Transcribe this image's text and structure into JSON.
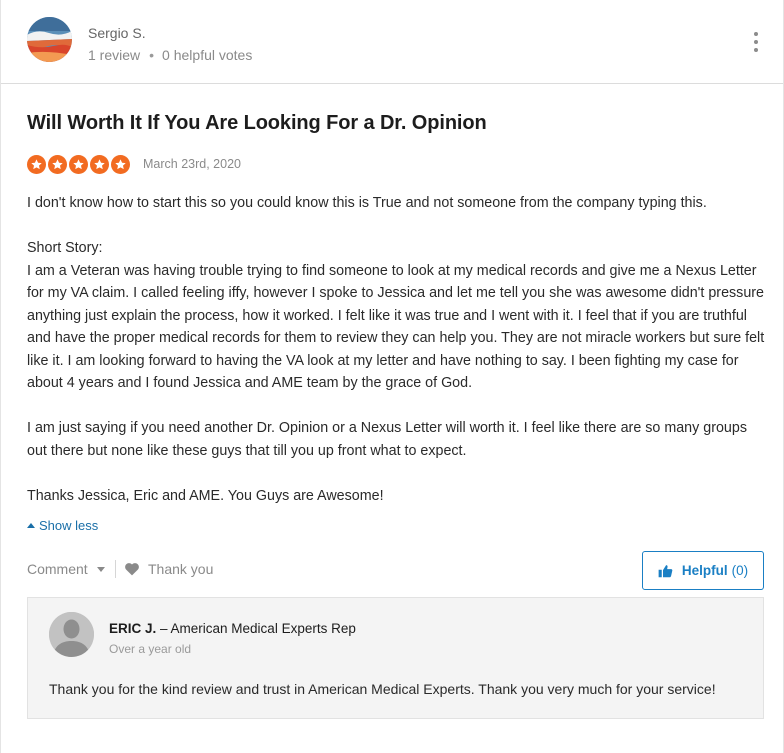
{
  "reviewer": {
    "name": "Sergio S.",
    "review_count": "1 review",
    "separator": "•",
    "helpful_votes": "0 helpful votes"
  },
  "review": {
    "title": "Will Worth It If You Are Looking For a Dr. Opinion",
    "rating": 5,
    "max_rating": 5,
    "date": "March 23rd, 2020",
    "paragraphs": [
      "I don't know how to start this so you could know this is True and not someone from the company typing this.",
      "Short Story:",
      "I am a Veteran was having trouble trying to find someone to look at my medical records and give me a Nexus Letter for my VA claim. I called feeling iffy, however I spoke to Jessica and let me tell you she was awesome didn't pressure anything just explain the process, how it worked. I felt like it was true and I went with it. I feel that if you are truthful and have the proper medical records for them to review they can help you. They are not miracle workers but sure felt like it. I am looking forward to having the VA look at my letter and have nothing to say. I been fighting my case for about 4 years and I found Jessica and AME team by the grace of God.",
      "I am just saying if you need another Dr. Opinion or a Nexus Letter will worth it. I feel like there are so many groups out there but none like these guys that till you up front what to expect.",
      "Thanks Jessica, Eric and AME. You Guys are Awesome!"
    ],
    "show_less_label": "Show less"
  },
  "actions": {
    "comment_label": "Comment",
    "thank_label": "Thank you",
    "helpful_label": "Helpful",
    "helpful_count": "(0)"
  },
  "reply": {
    "author": "ERIC J.",
    "role": " – American Medical Experts Rep",
    "date": "Over a year old",
    "text": "Thank you for the kind review and trust in American Medical Experts. Thank you very much for your service!"
  },
  "icons": {
    "more": "more-vertical-icon",
    "star": "star-icon",
    "heart": "heart-icon",
    "thumbs_up": "thumbs-up-icon",
    "caret_up": "caret-up-icon",
    "caret_down": "caret-down-icon",
    "avatar_placeholder": "user-silhouette-icon"
  },
  "colors": {
    "star": "#f26b21",
    "link": "#1a6fa8",
    "helpful": "#1a7fc4"
  }
}
